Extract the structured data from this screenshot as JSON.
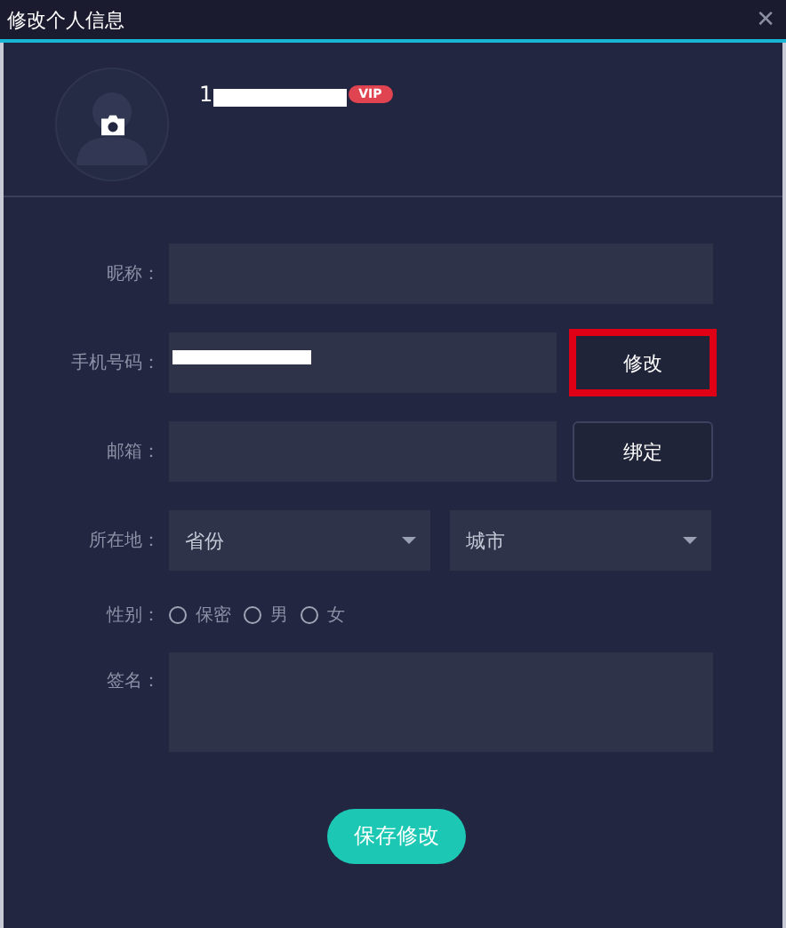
{
  "window": {
    "title": "修改个人信息",
    "close": "✕"
  },
  "profile": {
    "username": "1",
    "username_redacted": true,
    "badge": "VIP"
  },
  "form": {
    "nickname": {
      "label": "昵称："
    },
    "phone": {
      "label": "手机号码：",
      "value_redacted": true,
      "button": {
        "label": "修改",
        "highlighted": true
      }
    },
    "email": {
      "label": "邮箱：",
      "button": {
        "label": "绑定",
        "highlighted": false
      }
    },
    "location": {
      "label": "所在地：",
      "selects": [
        {
          "value": "省份"
        },
        {
          "value": "城市"
        }
      ]
    },
    "gender": {
      "label": "性别：",
      "options": [
        {
          "label": "保密",
          "selected": false
        },
        {
          "label": "男",
          "selected": false
        },
        {
          "label": "女",
          "selected": false
        }
      ]
    },
    "signature": {
      "label": "签名："
    }
  },
  "save_button": "保存修改"
}
